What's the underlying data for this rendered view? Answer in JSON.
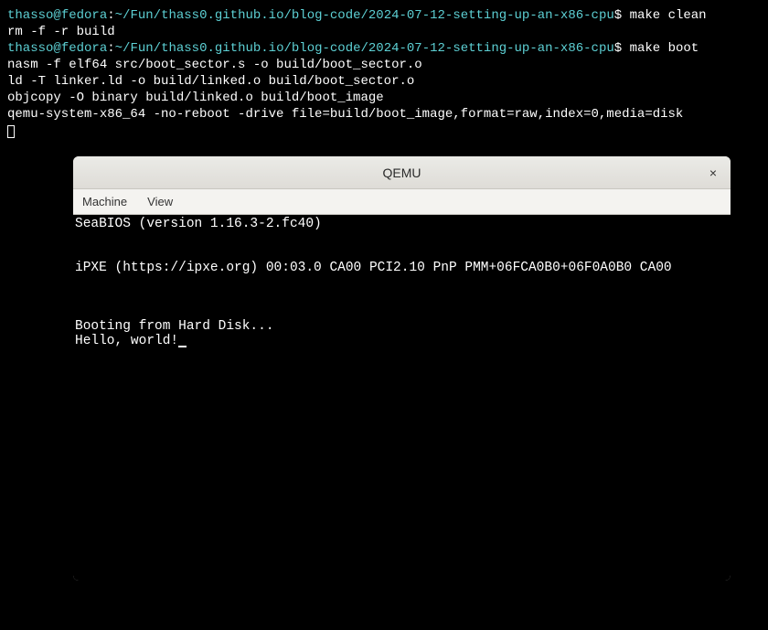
{
  "terminal": {
    "prompt1": {
      "user": "thasso",
      "at": "@",
      "host": "fedora",
      "colon": ":",
      "path": "~/Fun/thass0.github.io/blog-code/2024-07-12-setting-up-an-x86-cpu",
      "dollar": "$ ",
      "command": "make clean"
    },
    "output1": "rm -f -r build",
    "prompt2": {
      "user": "thasso",
      "at": "@",
      "host": "fedora",
      "colon": ":",
      "path": "~/Fun/thass0.github.io/blog-code/2024-07-12-setting-up-an-x86-cpu",
      "dollar": "$ ",
      "command": "make boot"
    },
    "output2": "nasm -f elf64 src/boot_sector.s -o build/boot_sector.o",
    "output3": "ld -T linker.ld -o build/linked.o build/boot_sector.o",
    "output4": "objcopy -O binary build/linked.o build/boot_image",
    "output5": "qemu-system-x86_64 -no-reboot -drive file=build/boot_image,format=raw,index=0,media=disk"
  },
  "qemu": {
    "title": "QEMU",
    "close": "×",
    "menu": {
      "machine": "Machine",
      "view": "View"
    },
    "lines": {
      "l1": "SeaBIOS (version 1.16.3-2.fc40)",
      "l2": "",
      "l3": "",
      "l4": "iPXE (https://ipxe.org) 00:03.0 CA00 PCI2.10 PnP PMM+06FCA0B0+06F0A0B0 CA00",
      "l5": "",
      "l6": "",
      "l7": "",
      "l8": "Booting from Hard Disk...",
      "l9": "Hello, world!"
    }
  }
}
